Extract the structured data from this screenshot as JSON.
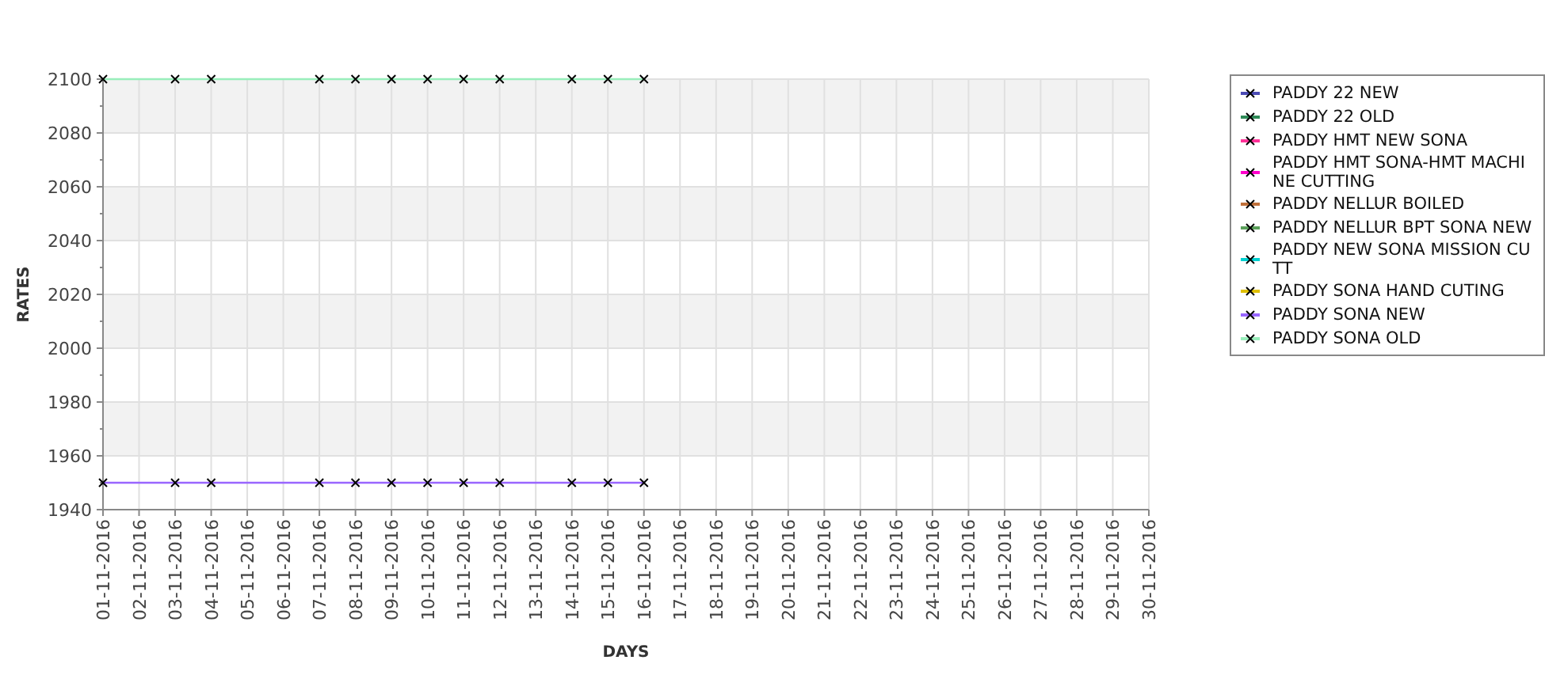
{
  "chart": {
    "chart_data": {
      "type": "line",
      "grid": true,
      "xlabel": "DAYS",
      "ylabel": "RATES",
      "ylim": [
        1940,
        2100
      ],
      "yticks": [
        1940,
        1960,
        1980,
        2000,
        2020,
        2040,
        2060,
        2080,
        2100
      ],
      "categories": [
        "01-11-2016",
        "02-11-2016",
        "03-11-2016",
        "04-11-2016",
        "05-11-2016",
        "06-11-2016",
        "07-11-2016",
        "08-11-2016",
        "09-11-2016",
        "10-11-2016",
        "11-11-2016",
        "12-11-2016",
        "13-11-2016",
        "14-11-2016",
        "15-11-2016",
        "16-11-2016",
        "17-11-2016",
        "18-11-2016",
        "19-11-2016",
        "20-11-2016",
        "21-11-2016",
        "22-11-2016",
        "23-11-2016",
        "24-11-2016",
        "25-11-2016",
        "26-11-2016",
        "27-11-2016",
        "28-11-2016",
        "29-11-2016",
        "30-11-2016"
      ],
      "series": [
        {
          "name": "PADDY 22 NEW",
          "color": "#4b4bb4",
          "marker": "x",
          "values": [
            null,
            null,
            null,
            null,
            null,
            null,
            null,
            null,
            null,
            null,
            null,
            null,
            null,
            null,
            null,
            null,
            null,
            null,
            null,
            null,
            null,
            null,
            null,
            null,
            null,
            null,
            null,
            null,
            null,
            null
          ]
        },
        {
          "name": "PADDY 22 OLD",
          "color": "#2e8b57",
          "marker": "x",
          "values": [
            null,
            null,
            null,
            null,
            null,
            null,
            null,
            null,
            null,
            null,
            null,
            null,
            null,
            null,
            null,
            null,
            null,
            null,
            null,
            null,
            null,
            null,
            null,
            null,
            null,
            null,
            null,
            null,
            null,
            null
          ]
        },
        {
          "name": "PADDY HMT NEW SONA",
          "color": "#ff3399",
          "marker": "x",
          "values": [
            null,
            null,
            null,
            null,
            null,
            null,
            null,
            null,
            null,
            null,
            null,
            null,
            null,
            null,
            null,
            null,
            null,
            null,
            null,
            null,
            null,
            null,
            null,
            null,
            null,
            null,
            null,
            null,
            null,
            null
          ]
        },
        {
          "name": "PADDY HMT SONA-HMT MACHINE CUTTING",
          "color": "#ff00cc",
          "marker": "x",
          "values": [
            null,
            null,
            null,
            null,
            null,
            null,
            null,
            null,
            null,
            null,
            null,
            null,
            null,
            null,
            null,
            null,
            null,
            null,
            null,
            null,
            null,
            null,
            null,
            null,
            null,
            null,
            null,
            null,
            null,
            null
          ]
        },
        {
          "name": "PADDY NELLUR BOILED",
          "color": "#c0703a",
          "marker": "x",
          "values": [
            null,
            null,
            null,
            null,
            null,
            null,
            null,
            null,
            null,
            null,
            null,
            null,
            null,
            null,
            null,
            null,
            null,
            null,
            null,
            null,
            null,
            null,
            null,
            null,
            null,
            null,
            null,
            null,
            null,
            null
          ]
        },
        {
          "name": "PADDY NELLUR BPT SONA NEW",
          "color": "#5aa05a",
          "marker": "x",
          "values": [
            null,
            null,
            null,
            null,
            null,
            null,
            null,
            null,
            null,
            null,
            null,
            null,
            null,
            null,
            null,
            null,
            null,
            null,
            null,
            null,
            null,
            null,
            null,
            null,
            null,
            null,
            null,
            null,
            null,
            null
          ]
        },
        {
          "name": "PADDY NEW SONA MISSION CUTT",
          "color": "#00d0d0",
          "marker": "x",
          "values": [
            null,
            null,
            null,
            null,
            null,
            null,
            null,
            null,
            null,
            null,
            null,
            null,
            null,
            null,
            null,
            null,
            null,
            null,
            null,
            null,
            null,
            null,
            null,
            null,
            null,
            null,
            null,
            null,
            null,
            null
          ]
        },
        {
          "name": "PADDY SONA HAND CUTING",
          "color": "#e0c000",
          "marker": "x",
          "values": [
            null,
            null,
            null,
            null,
            null,
            null,
            null,
            null,
            null,
            null,
            null,
            null,
            null,
            null,
            null,
            null,
            null,
            null,
            null,
            null,
            null,
            null,
            null,
            null,
            null,
            null,
            null,
            null,
            null,
            null
          ]
        },
        {
          "name": "PADDY SONA NEW",
          "color": "#9966ff",
          "marker": "x",
          "values": [
            1950,
            null,
            1950,
            1950,
            null,
            null,
            1950,
            1950,
            1950,
            1950,
            1950,
            1950,
            null,
            1950,
            1950,
            1950,
            null,
            null,
            null,
            null,
            null,
            null,
            null,
            null,
            null,
            null,
            null,
            null,
            null,
            null
          ]
        },
        {
          "name": "PADDY SONA OLD",
          "color": "#99eebb",
          "marker": "x",
          "values": [
            2100,
            null,
            2100,
            2100,
            null,
            null,
            2100,
            2100,
            2100,
            2100,
            2100,
            2100,
            null,
            2100,
            2100,
            2100,
            null,
            null,
            null,
            null,
            null,
            null,
            null,
            null,
            null,
            null,
            null,
            null,
            null,
            null
          ]
        }
      ]
    }
  }
}
